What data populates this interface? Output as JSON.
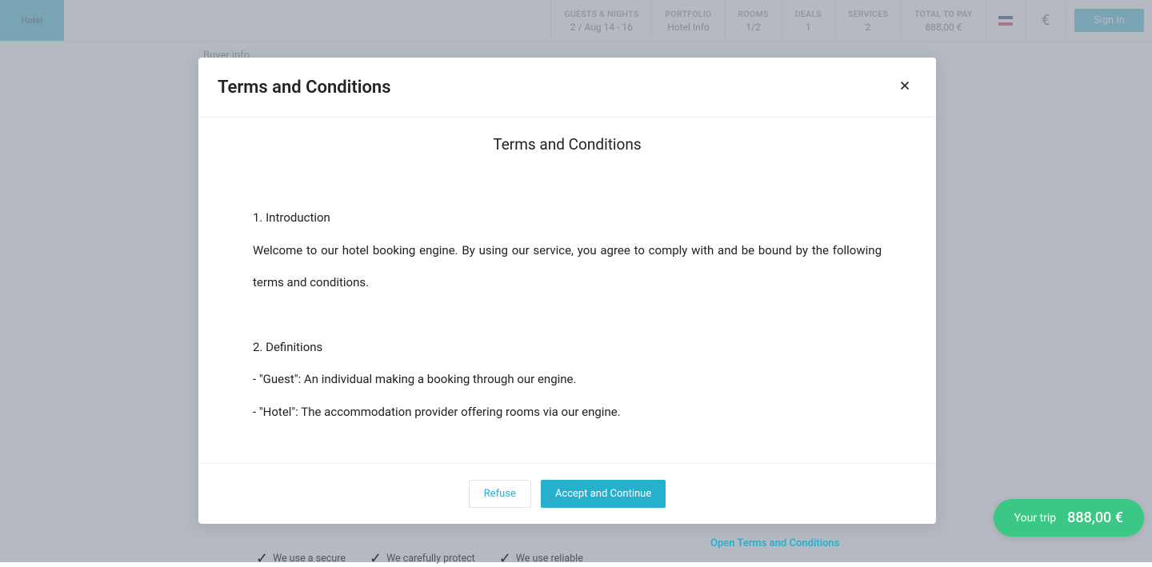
{
  "logo": {
    "text": "Hotel"
  },
  "header": {
    "guests_nights": {
      "label": "GUESTS & NIGHTS",
      "value": "2 / Aug 14 - 16"
    },
    "portfolio": {
      "label": "PORTFOLIO",
      "value": "Hotel Info"
    },
    "rooms": {
      "label": "ROOMS",
      "value": "1/2"
    },
    "deals": {
      "label": "DEALS",
      "value": "1"
    },
    "services": {
      "label": "SERVICES",
      "value": "2"
    },
    "total": {
      "label": "TOTAL TO PAY",
      "value": "888,00 €"
    },
    "currency": "€",
    "sign_in": "Sign In"
  },
  "page": {
    "buyer_info": "Buyer info",
    "open_terms": "Open Terms and Conditions",
    "benefits": {
      "b1": "We use a secure",
      "b2": "We carefully protect",
      "b3": "We use reliable"
    }
  },
  "modal": {
    "header_title": "Terms and Conditions",
    "body_title": "Terms and Conditions",
    "sections": {
      "s1_title": "1. Introduction",
      "s1_body": "Welcome to our hotel booking engine. By using our service, you agree to comply with and be bound by the following terms and conditions.",
      "s2_title": "2. Definitions",
      "s2_line1": "- \"Guest\": An individual making a booking through our engine.",
      "s2_line2": "- \"Hotel\": The accommodation provider offering rooms via our engine."
    },
    "refuse": "Refuse",
    "accept": "Accept and Continue"
  },
  "trip_pill": {
    "label": "Your trip",
    "price": "888,00 €"
  }
}
